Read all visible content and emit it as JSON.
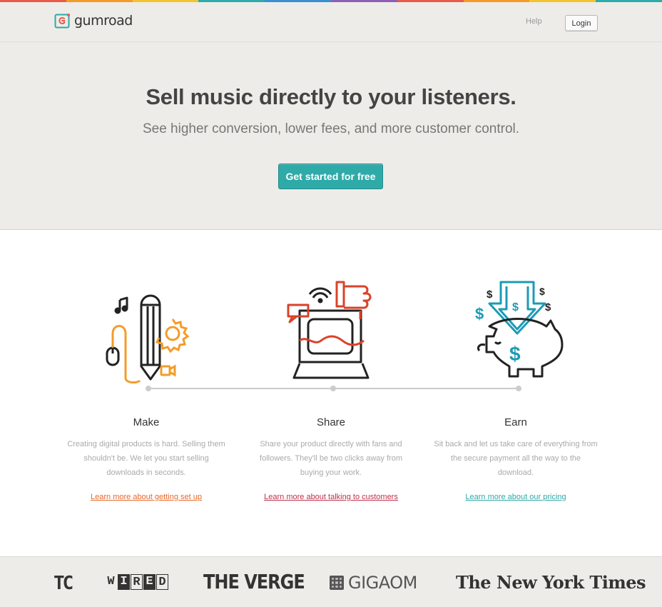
{
  "top_stripe_colors": [
    "#e85b4a",
    "#f39c2a",
    "#f4c430",
    "#2eaaa8",
    "#3b8fd0",
    "#8e5fb5",
    "#e85b4a",
    "#f39c2a",
    "#f4c430",
    "#2eaaa8"
  ],
  "header": {
    "logo_text": "gumroad",
    "help_label": "Help",
    "login_label": "Login"
  },
  "hero": {
    "title": "Sell music directly to your listeners.",
    "subtitle": "See higher conversion, lower fees, and more customer control.",
    "cta_label": "Get started for free",
    "cta_color": "#2eaaa8"
  },
  "features": [
    {
      "title": "Make",
      "text": "Creating digital products is hard. Selling them shouldn't be. We let you start selling downloads in seconds.",
      "link": "Learn more about getting set up",
      "link_color": "#e8682b",
      "icon": "pencil-gear-icon"
    },
    {
      "title": "Share",
      "text": "Share your product directly with fans and followers. They'll be two clicks away from buying your work.",
      "link": "Learn more about talking to customers",
      "link_color": "#c0304a",
      "icon": "computer-thumbs-up-icon"
    },
    {
      "title": "Earn",
      "text": "Sit back and let us take care of everything from the secure payment all the way to the download.",
      "link": "Learn more about our pricing",
      "link_color": "#2eaaa8",
      "icon": "piggy-bank-icon"
    }
  ],
  "press": {
    "tc": "TC",
    "wired": [
      "W",
      "I",
      "R",
      "E",
      "D"
    ],
    "verge": "THE VERGE",
    "gigaom": "GIGAOM",
    "nyt": "The New York Times"
  }
}
